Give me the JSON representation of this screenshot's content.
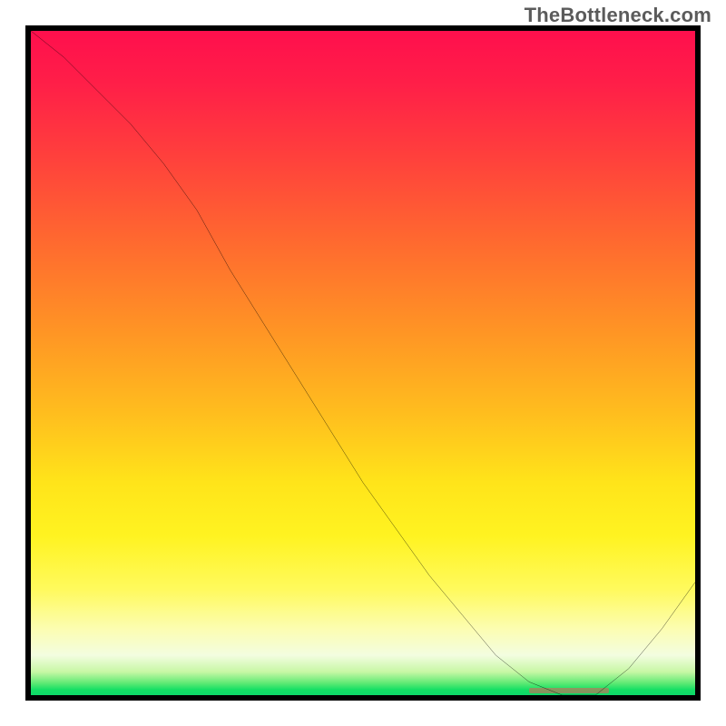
{
  "watermark_text": "TheBottleneck.com",
  "chart_data": {
    "type": "line",
    "title": "",
    "xlabel": "",
    "ylabel": "",
    "xlim": [
      0,
      100
    ],
    "ylim": [
      0,
      100
    ],
    "grid": false,
    "legend": false,
    "background": {
      "style": "vertical-gradient",
      "stops": [
        {
          "pos": 0,
          "color": "#ff0f4d"
        },
        {
          "pos": 18,
          "color": "#ff3d3d"
        },
        {
          "pos": 46,
          "color": "#ff9724"
        },
        {
          "pos": 68,
          "color": "#ffe41a"
        },
        {
          "pos": 90,
          "color": "#fcfdb1"
        },
        {
          "pos": 98,
          "color": "#5eea74"
        },
        {
          "pos": 100,
          "color": "#0cd968"
        }
      ]
    },
    "series": [
      {
        "name": "bottleneck-curve",
        "color": "#000000",
        "x": [
          0,
          5,
          10,
          15,
          20,
          25,
          30,
          35,
          40,
          45,
          50,
          55,
          60,
          65,
          70,
          75,
          80,
          85,
          90,
          95,
          100
        ],
        "y": [
          100,
          96,
          91,
          86,
          80,
          73,
          64,
          56,
          48,
          40,
          32,
          25,
          18,
          12,
          6,
          2,
          0,
          0,
          4,
          10,
          17
        ]
      }
    ],
    "annotations": [
      {
        "name": "optimal-range-marker",
        "type": "baseline-band",
        "x_start": 75,
        "x_end": 87,
        "color": "#e85a5a"
      }
    ]
  }
}
